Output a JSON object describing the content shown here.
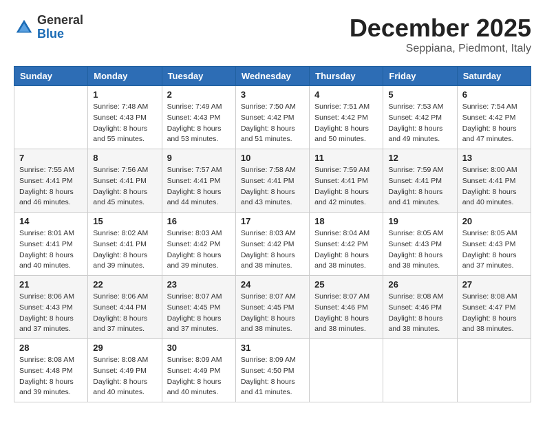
{
  "logo": {
    "general": "General",
    "blue": "Blue"
  },
  "header": {
    "month": "December 2025",
    "location": "Seppiana, Piedmont, Italy"
  },
  "weekdays": [
    "Sunday",
    "Monday",
    "Tuesday",
    "Wednesday",
    "Thursday",
    "Friday",
    "Saturday"
  ],
  "weeks": [
    [
      {
        "day": "",
        "sunrise": "",
        "sunset": "",
        "daylight": ""
      },
      {
        "day": "1",
        "sunrise": "Sunrise: 7:48 AM",
        "sunset": "Sunset: 4:43 PM",
        "daylight": "Daylight: 8 hours and 55 minutes."
      },
      {
        "day": "2",
        "sunrise": "Sunrise: 7:49 AM",
        "sunset": "Sunset: 4:43 PM",
        "daylight": "Daylight: 8 hours and 53 minutes."
      },
      {
        "day": "3",
        "sunrise": "Sunrise: 7:50 AM",
        "sunset": "Sunset: 4:42 PM",
        "daylight": "Daylight: 8 hours and 51 minutes."
      },
      {
        "day": "4",
        "sunrise": "Sunrise: 7:51 AM",
        "sunset": "Sunset: 4:42 PM",
        "daylight": "Daylight: 8 hours and 50 minutes."
      },
      {
        "day": "5",
        "sunrise": "Sunrise: 7:53 AM",
        "sunset": "Sunset: 4:42 PM",
        "daylight": "Daylight: 8 hours and 49 minutes."
      },
      {
        "day": "6",
        "sunrise": "Sunrise: 7:54 AM",
        "sunset": "Sunset: 4:42 PM",
        "daylight": "Daylight: 8 hours and 47 minutes."
      }
    ],
    [
      {
        "day": "7",
        "sunrise": "Sunrise: 7:55 AM",
        "sunset": "Sunset: 4:41 PM",
        "daylight": "Daylight: 8 hours and 46 minutes."
      },
      {
        "day": "8",
        "sunrise": "Sunrise: 7:56 AM",
        "sunset": "Sunset: 4:41 PM",
        "daylight": "Daylight: 8 hours and 45 minutes."
      },
      {
        "day": "9",
        "sunrise": "Sunrise: 7:57 AM",
        "sunset": "Sunset: 4:41 PM",
        "daylight": "Daylight: 8 hours and 44 minutes."
      },
      {
        "day": "10",
        "sunrise": "Sunrise: 7:58 AM",
        "sunset": "Sunset: 4:41 PM",
        "daylight": "Daylight: 8 hours and 43 minutes."
      },
      {
        "day": "11",
        "sunrise": "Sunrise: 7:59 AM",
        "sunset": "Sunset: 4:41 PM",
        "daylight": "Daylight: 8 hours and 42 minutes."
      },
      {
        "day": "12",
        "sunrise": "Sunrise: 7:59 AM",
        "sunset": "Sunset: 4:41 PM",
        "daylight": "Daylight: 8 hours and 41 minutes."
      },
      {
        "day": "13",
        "sunrise": "Sunrise: 8:00 AM",
        "sunset": "Sunset: 4:41 PM",
        "daylight": "Daylight: 8 hours and 40 minutes."
      }
    ],
    [
      {
        "day": "14",
        "sunrise": "Sunrise: 8:01 AM",
        "sunset": "Sunset: 4:41 PM",
        "daylight": "Daylight: 8 hours and 40 minutes."
      },
      {
        "day": "15",
        "sunrise": "Sunrise: 8:02 AM",
        "sunset": "Sunset: 4:41 PM",
        "daylight": "Daylight: 8 hours and 39 minutes."
      },
      {
        "day": "16",
        "sunrise": "Sunrise: 8:03 AM",
        "sunset": "Sunset: 4:42 PM",
        "daylight": "Daylight: 8 hours and 39 minutes."
      },
      {
        "day": "17",
        "sunrise": "Sunrise: 8:03 AM",
        "sunset": "Sunset: 4:42 PM",
        "daylight": "Daylight: 8 hours and 38 minutes."
      },
      {
        "day": "18",
        "sunrise": "Sunrise: 8:04 AM",
        "sunset": "Sunset: 4:42 PM",
        "daylight": "Daylight: 8 hours and 38 minutes."
      },
      {
        "day": "19",
        "sunrise": "Sunrise: 8:05 AM",
        "sunset": "Sunset: 4:43 PM",
        "daylight": "Daylight: 8 hours and 38 minutes."
      },
      {
        "day": "20",
        "sunrise": "Sunrise: 8:05 AM",
        "sunset": "Sunset: 4:43 PM",
        "daylight": "Daylight: 8 hours and 37 minutes."
      }
    ],
    [
      {
        "day": "21",
        "sunrise": "Sunrise: 8:06 AM",
        "sunset": "Sunset: 4:43 PM",
        "daylight": "Daylight: 8 hours and 37 minutes."
      },
      {
        "day": "22",
        "sunrise": "Sunrise: 8:06 AM",
        "sunset": "Sunset: 4:44 PM",
        "daylight": "Daylight: 8 hours and 37 minutes."
      },
      {
        "day": "23",
        "sunrise": "Sunrise: 8:07 AM",
        "sunset": "Sunset: 4:45 PM",
        "daylight": "Daylight: 8 hours and 37 minutes."
      },
      {
        "day": "24",
        "sunrise": "Sunrise: 8:07 AM",
        "sunset": "Sunset: 4:45 PM",
        "daylight": "Daylight: 8 hours and 38 minutes."
      },
      {
        "day": "25",
        "sunrise": "Sunrise: 8:07 AM",
        "sunset": "Sunset: 4:46 PM",
        "daylight": "Daylight: 8 hours and 38 minutes."
      },
      {
        "day": "26",
        "sunrise": "Sunrise: 8:08 AM",
        "sunset": "Sunset: 4:46 PM",
        "daylight": "Daylight: 8 hours and 38 minutes."
      },
      {
        "day": "27",
        "sunrise": "Sunrise: 8:08 AM",
        "sunset": "Sunset: 4:47 PM",
        "daylight": "Daylight: 8 hours and 38 minutes."
      }
    ],
    [
      {
        "day": "28",
        "sunrise": "Sunrise: 8:08 AM",
        "sunset": "Sunset: 4:48 PM",
        "daylight": "Daylight: 8 hours and 39 minutes."
      },
      {
        "day": "29",
        "sunrise": "Sunrise: 8:08 AM",
        "sunset": "Sunset: 4:49 PM",
        "daylight": "Daylight: 8 hours and 40 minutes."
      },
      {
        "day": "30",
        "sunrise": "Sunrise: 8:09 AM",
        "sunset": "Sunset: 4:49 PM",
        "daylight": "Daylight: 8 hours and 40 minutes."
      },
      {
        "day": "31",
        "sunrise": "Sunrise: 8:09 AM",
        "sunset": "Sunset: 4:50 PM",
        "daylight": "Daylight: 8 hours and 41 minutes."
      },
      {
        "day": "",
        "sunrise": "",
        "sunset": "",
        "daylight": ""
      },
      {
        "day": "",
        "sunrise": "",
        "sunset": "",
        "daylight": ""
      },
      {
        "day": "",
        "sunrise": "",
        "sunset": "",
        "daylight": ""
      }
    ]
  ]
}
